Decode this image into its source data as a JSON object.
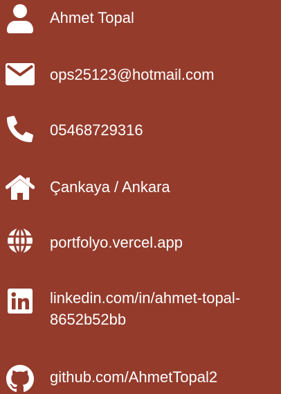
{
  "colors": {
    "background": "#943B2C",
    "foreground": "#FFFFFF"
  },
  "contacts": [
    {
      "icon": "user-icon",
      "text": "Ahmet Topal"
    },
    {
      "icon": "envelope-icon",
      "text": "ops25123@hotmail.com"
    },
    {
      "icon": "phone-icon",
      "text": "05468729316"
    },
    {
      "icon": "home-icon",
      "text": "Çankaya / Ankara"
    },
    {
      "icon": "globe-icon",
      "text": "portfolyo.vercel.app"
    },
    {
      "icon": "linkedin-icon",
      "text_line1": "linkedin.com/in/ahmet-topal-",
      "text_line2": "8652b52bb"
    },
    {
      "icon": "github-icon",
      "text": "github.com/AhmetTopal2"
    }
  ]
}
